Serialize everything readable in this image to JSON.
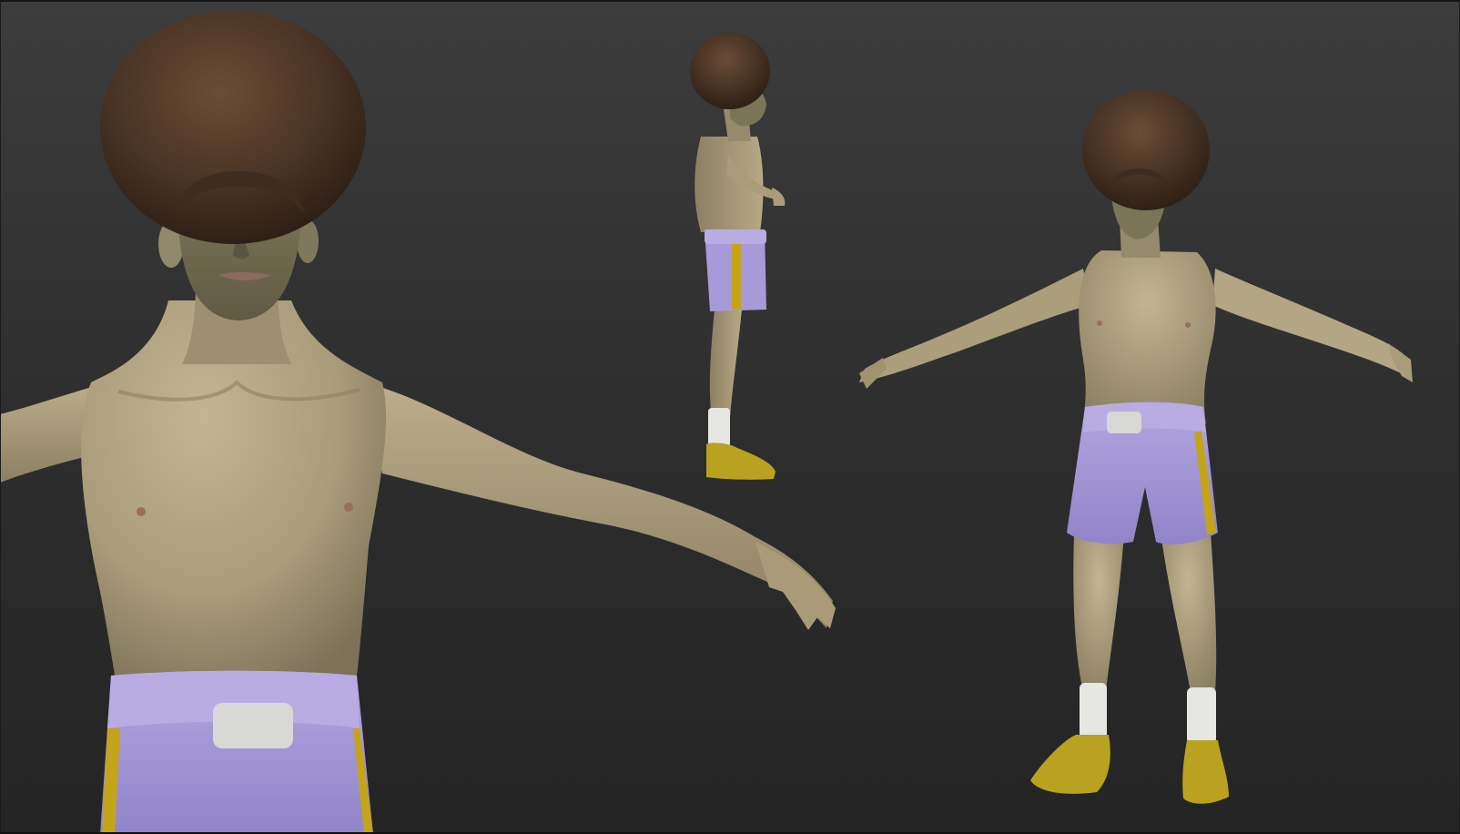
{
  "scene": {
    "background_color": "#2e2e2e",
    "views": [
      "closeup-front",
      "side-profile",
      "full-body-three-quarter"
    ]
  },
  "materials": {
    "skin": "#b3a684",
    "skin_shadow": "#8a7e62",
    "face": "#7c7658",
    "hair": "#4a3424",
    "hair_highlight": "#6b4d36",
    "shorts": "#a89ad8",
    "shorts_shadow": "#8a7cc0",
    "stripe": "#c4a419",
    "buckle": "#d8d8d4",
    "socks": "#e6e6e2",
    "shoes": "#b8a21f"
  }
}
